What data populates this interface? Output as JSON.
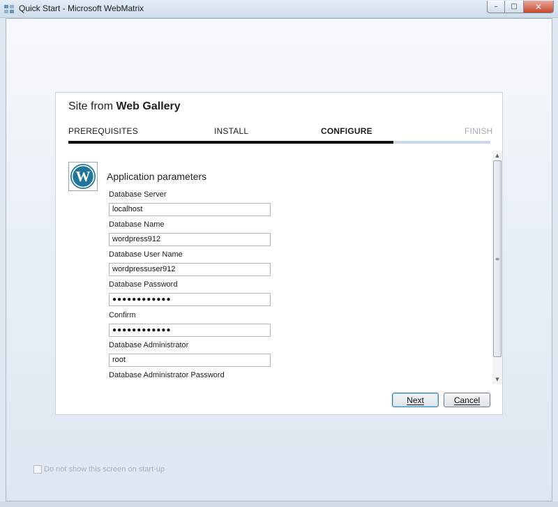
{
  "window": {
    "title": "Quick Start - Microsoft WebMatrix",
    "minimize_glyph": "–",
    "maximize_glyph": "□",
    "close_glyph": "✕"
  },
  "panel": {
    "title_prefix": "Site from ",
    "title_bold": "Web Gallery"
  },
  "steps": [
    {
      "label": "PREREQUISITES",
      "state": "done"
    },
    {
      "label": "INSTALL",
      "state": "done"
    },
    {
      "label": "CONFIGURE",
      "state": "active"
    },
    {
      "label": "FINISH",
      "state": "future"
    }
  ],
  "progress": {
    "fraction": 0.77
  },
  "section": {
    "icon": "wordpress-logo",
    "logo_letter": "W",
    "title": "Application parameters"
  },
  "fields": [
    {
      "label": "Database Server",
      "value": "localhost",
      "type": "text"
    },
    {
      "label": "Database Name",
      "value": "wordpress912",
      "type": "text"
    },
    {
      "label": "Database User Name",
      "value": "wordpressuser912",
      "type": "text"
    },
    {
      "label": "Database Password",
      "value": "●●●●●●●●●●●●",
      "type": "password"
    },
    {
      "label": "Confirm",
      "value": "●●●●●●●●●●●●",
      "type": "password"
    },
    {
      "label": "Database Administrator",
      "value": "root",
      "type": "text"
    },
    {
      "label": "Database Administrator Password"
    }
  ],
  "scrollbar": {
    "up": "▲",
    "down": "▼",
    "grip": "≡"
  },
  "buttons": {
    "next": "Next",
    "cancel": "Cancel"
  },
  "startup": {
    "label": "Do not show this screen on start-up",
    "checked": false
  },
  "colors": {
    "progress_fill": "#111111",
    "progress_track": "#c9d8e6",
    "wordpress_blue": "#21759b"
  }
}
